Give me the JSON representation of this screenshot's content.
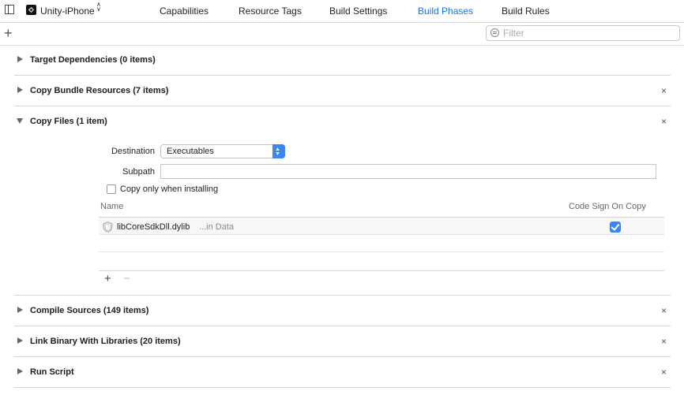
{
  "header": {
    "target_name": "Unity-iPhone",
    "tabs": [
      {
        "label": "Capabilities"
      },
      {
        "label": "Resource Tags"
      },
      {
        "label": "Build Settings"
      },
      {
        "label": "Build Phases"
      },
      {
        "label": "Build Rules"
      }
    ],
    "active_tab": "Build Phases",
    "accent_color": "#1a73d9"
  },
  "toolbar": {
    "add_symbol": "+",
    "filter_placeholder": "Filter"
  },
  "phases": [
    {
      "title": "Target Dependencies (0 items)",
      "expanded": false,
      "removable": false
    },
    {
      "title": "Copy Bundle Resources (7 items)",
      "expanded": false,
      "removable": true
    },
    {
      "title": "Copy Files (1 item)",
      "expanded": true,
      "removable": true
    },
    {
      "title": "Compile Sources (149 items)",
      "expanded": false,
      "removable": true
    },
    {
      "title": "Link Binary With Libraries (20 items)",
      "expanded": false,
      "removable": true
    },
    {
      "title": "Run Script",
      "expanded": false,
      "removable": true
    }
  ],
  "copy_files": {
    "destination_label": "Destination",
    "destination_value": "Executables",
    "subpath_label": "Subpath",
    "subpath_value": "",
    "copy_only_label": "Copy only when installing",
    "copy_only_checked": false,
    "columns": {
      "name": "Name",
      "code_sign": "Code Sign On Copy"
    },
    "files": [
      {
        "name": "libCoreSdkDll.dylib",
        "location": "...in Data",
        "code_sign": true
      }
    ],
    "add_symbol": "+",
    "remove_symbol": "−"
  },
  "icons": {
    "close": "×",
    "chevron_updown": "⌃⌄"
  }
}
